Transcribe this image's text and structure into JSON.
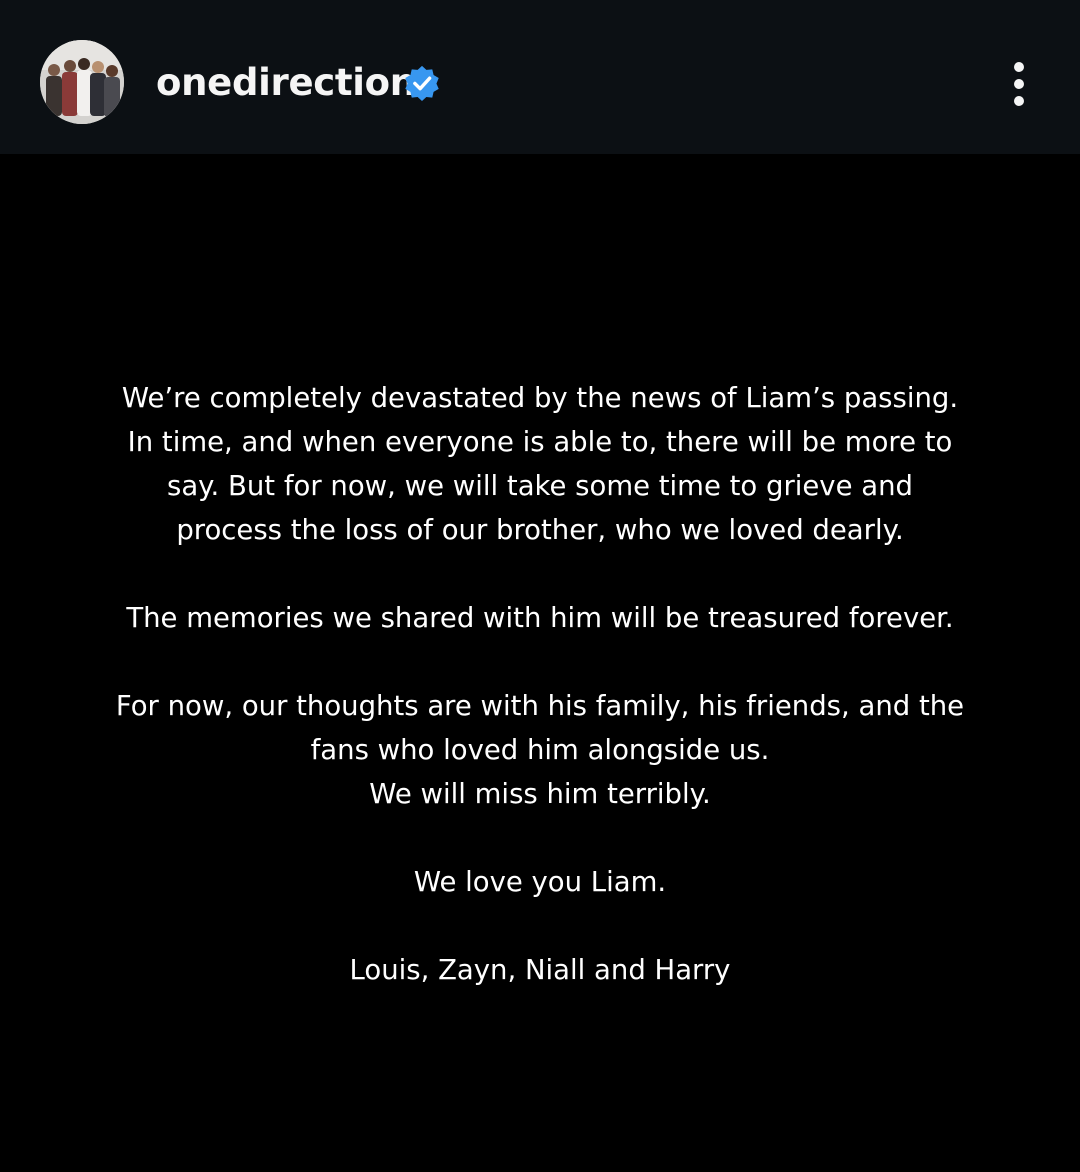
{
  "header": {
    "username": "onedirection",
    "verified_color": "#3897f0",
    "avatar_icon": "group-photo-avatar",
    "more_icon": "vertical-ellipsis-icon"
  },
  "post": {
    "paragraphs": [
      {
        "lines": [
          "We’re completely devastated by the news of Liam’s passing.",
          "In time, and when everyone is able to, there will be more to",
          "say. But for now, we will take some time to grieve and",
          "process the loss of our brother, who we loved dearly."
        ]
      },
      {
        "lines": [
          "The memories we shared with him will be treasured forever."
        ]
      },
      {
        "lines": [
          "For now, our thoughts are with his family, his friends, and the",
          "fans who loved him alongside us.",
          "We will miss him terribly."
        ]
      },
      {
        "lines": [
          "We love you Liam."
        ]
      },
      {
        "lines": [
          "Louis, Zayn, Niall and Harry"
        ]
      }
    ]
  }
}
